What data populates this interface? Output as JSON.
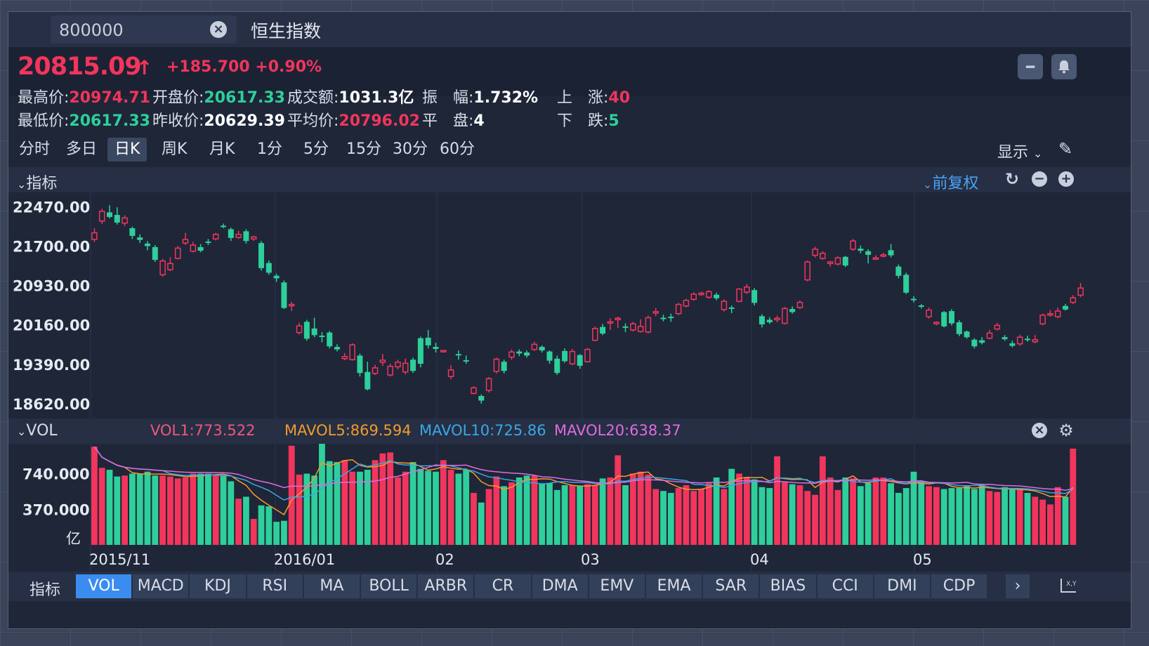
{
  "header": {
    "search_value": "800000",
    "index_name": "恒生指数"
  },
  "quote": {
    "price": "20815.09",
    "change": "+185.700",
    "change_pct": "+0.90%",
    "stats": {
      "high_label": "最高价:",
      "high": "20974.71",
      "open_label": "开盘价:",
      "open": "20617.33",
      "turnover_label": "成交额:",
      "turnover": "1031.3亿",
      "amp_label": "振　幅:",
      "amp": "1.732%",
      "up_label": "上　涨:",
      "up": "40",
      "low_label": "最低价:",
      "low": "20617.33",
      "prev_label": "昨收价:",
      "prev": "20629.39",
      "avg_label": "平均价:",
      "avg": "20796.02",
      "flat_label": "平　盘:",
      "flat": "4",
      "down_label": "下　跌:",
      "down": "5"
    }
  },
  "periods": [
    "分时",
    "多日",
    "日K",
    "周K",
    "月K",
    "1分",
    "5分",
    "15分",
    "30分",
    "60分"
  ],
  "active_period": "日K",
  "display_label": "显示",
  "indicator_section": {
    "label": "指标",
    "adjust": "前复权"
  },
  "vol_section": {
    "label": "VOL",
    "vol1": "VOL1:773.522",
    "mavol5": "MAVOL5:869.594",
    "mavol10": "MAVOL10:725.86",
    "mavol20": "MAVOL20:638.37"
  },
  "colors": {
    "up": "#f2355c",
    "down": "#2ecf9a",
    "ma5": "#f39a2c",
    "ma10": "#3aa8e6",
    "ma20": "#e06be0"
  },
  "chart_data": {
    "type": "candlestick",
    "y_ticks": [
      "22470.00",
      "21700.00",
      "20930.00",
      "20160.00",
      "19390.00",
      "18620.00"
    ],
    "ylim": [
      18330,
      22750
    ],
    "x_labels": [
      "2015/11",
      "2016/01",
      "02",
      "03",
      "04",
      "05"
    ],
    "candles": [
      [
        21830,
        21960,
        21780,
        22050
      ],
      [
        22190,
        22380,
        22130,
        22430
      ],
      [
        22360,
        22270,
        22240,
        22500
      ],
      [
        22310,
        22160,
        22120,
        22460
      ],
      [
        22150,
        22250,
        22090,
        22300
      ],
      [
        22050,
        21900,
        21840,
        22080
      ],
      [
        21870,
        21820,
        21760,
        21930
      ],
      [
        21750,
        21700,
        21620,
        21800
      ],
      [
        21680,
        21430,
        21390,
        21720
      ],
      [
        21140,
        21410,
        21100,
        21450
      ],
      [
        21240,
        21360,
        21210,
        21480
      ],
      [
        21460,
        21660,
        21440,
        21700
      ],
      [
        21760,
        21830,
        21720,
        21960
      ],
      [
        21600,
        21720,
        21580,
        21780
      ],
      [
        21680,
        21610,
        21580,
        21740
      ],
      [
        21790,
        21780,
        21720,
        21840
      ],
      [
        21840,
        21930,
        21810,
        21960
      ],
      [
        22100,
        22080,
        22050,
        22140
      ],
      [
        22030,
        21860,
        21800,
        22060
      ],
      [
        21870,
        21930,
        21840,
        22000
      ],
      [
        21990,
        21800,
        21750,
        22030
      ],
      [
        21840,
        21880,
        21800,
        21900
      ],
      [
        21760,
        21270,
        21220,
        21800
      ],
      [
        21370,
        21180,
        21140,
        21420
      ],
      [
        21120,
        21070,
        21000,
        21160
      ],
      [
        20990,
        20490,
        20470,
        21030
      ],
      [
        20540,
        20560,
        20430,
        20610
      ],
      [
        20010,
        20140,
        19970,
        20200
      ],
      [
        20220,
        19890,
        19850,
        20260
      ],
      [
        20090,
        19960,
        19920,
        20300
      ],
      [
        19950,
        19930,
        19820,
        20020
      ],
      [
        20010,
        19740,
        19700,
        20040
      ],
      [
        19730,
        19680,
        19640,
        19780
      ],
      [
        19500,
        19540,
        19470,
        19610
      ],
      [
        19480,
        19770,
        19460,
        19800
      ],
      [
        19560,
        19220,
        19150,
        19600
      ],
      [
        19240,
        18900,
        18880,
        19440
      ],
      [
        19210,
        19320,
        19180,
        19380
      ],
      [
        19430,
        19470,
        19360,
        19590
      ],
      [
        19180,
        19350,
        19150,
        19400
      ],
      [
        19340,
        19430,
        19290,
        19480
      ],
      [
        19240,
        19410,
        19190,
        19500
      ],
      [
        19480,
        19260,
        19220,
        19520
      ],
      [
        19900,
        19400,
        19330,
        19930
      ],
      [
        19910,
        19760,
        19700,
        20060
      ],
      [
        19730,
        19690,
        19620,
        19810
      ],
      [
        19650,
        19660,
        19620,
        19670
      ],
      [
        19150,
        19280,
        19100,
        19370
      ],
      [
        19590,
        19570,
        19480,
        19660
      ],
      [
        19470,
        19450,
        19400,
        19560
      ],
      [
        18820,
        18930,
        18800,
        18960
      ],
      [
        18770,
        18680,
        18620,
        18800
      ],
      [
        18880,
        19110,
        18840,
        19140
      ],
      [
        19250,
        19490,
        19210,
        19520
      ],
      [
        19440,
        19260,
        19210,
        19480
      ],
      [
        19530,
        19630,
        19480,
        19680
      ],
      [
        19640,
        19600,
        19550,
        19680
      ],
      [
        19620,
        19560,
        19520,
        19660
      ],
      [
        19680,
        19780,
        19650,
        19830
      ],
      [
        19730,
        19660,
        19620,
        19760
      ],
      [
        19640,
        19460,
        19400,
        19660
      ],
      [
        19500,
        19220,
        19180,
        19560
      ],
      [
        19650,
        19450,
        19420,
        19700
      ],
      [
        19400,
        19640,
        19370,
        19690
      ],
      [
        19570,
        19360,
        19300,
        19590
      ],
      [
        19440,
        19680,
        19420,
        19710
      ],
      [
        19860,
        20090,
        19840,
        20130
      ],
      [
        20120,
        19990,
        19960,
        20180
      ],
      [
        20220,
        20220,
        20060,
        20290
      ],
      [
        20270,
        20290,
        20100,
        20320
      ],
      [
        20130,
        20120,
        20020,
        20190
      ],
      [
        20060,
        20180,
        20030,
        20220
      ],
      [
        20030,
        20130,
        20010,
        20270
      ],
      [
        20020,
        20300,
        19990,
        20340
      ],
      [
        20400,
        20420,
        20330,
        20490
      ],
      [
        20300,
        20290,
        20230,
        20360
      ],
      [
        20320,
        20310,
        20220,
        20380
      ],
      [
        20380,
        20560,
        20350,
        20590
      ],
      [
        20530,
        20640,
        20500,
        20670
      ],
      [
        20660,
        20760,
        20630,
        20800
      ],
      [
        20760,
        20780,
        20730,
        20810
      ],
      [
        20700,
        20810,
        20670,
        20840
      ],
      [
        20750,
        20680,
        20640,
        20790
      ],
      [
        20460,
        20620,
        20420,
        20660
      ],
      [
        20500,
        20480,
        20390,
        20540
      ],
      [
        20620,
        20860,
        20600,
        20880
      ],
      [
        20800,
        20900,
        20760,
        20960
      ],
      [
        20840,
        20590,
        20540,
        20880
      ],
      [
        20330,
        20170,
        20110,
        20370
      ],
      [
        20260,
        20210,
        20180,
        20310
      ],
      [
        20260,
        20290,
        20210,
        20340
      ],
      [
        20190,
        20480,
        20170,
        20510
      ],
      [
        20470,
        20410,
        20380,
        20520
      ],
      [
        20500,
        20600,
        20470,
        20640
      ],
      [
        21040,
        21390,
        21010,
        21420
      ],
      [
        21520,
        21640,
        21480,
        21690
      ],
      [
        21460,
        21560,
        21430,
        21600
      ],
      [
        21360,
        21390,
        21300,
        21410
      ],
      [
        21350,
        21470,
        21320,
        21500
      ],
      [
        21490,
        21320,
        21290,
        21510
      ],
      [
        21640,
        21800,
        21610,
        21840
      ],
      [
        21650,
        21610,
        21560,
        21710
      ],
      [
        21600,
        21530,
        21360,
        21640
      ],
      [
        21460,
        21470,
        21430,
        21520
      ],
      [
        21520,
        21530,
        21480,
        21570
      ],
      [
        21620,
        21520,
        21480,
        21740
      ],
      [
        21300,
        21120,
        21070,
        21340
      ],
      [
        21140,
        20790,
        20760,
        21180
      ],
      [
        20670,
        20650,
        20600,
        20720
      ],
      [
        20540,
        20530,
        20480,
        20570
      ],
      [
        20320,
        20450,
        20280,
        20500
      ],
      [
        20180,
        20210,
        20150,
        20230
      ],
      [
        20410,
        20130,
        20110,
        20430
      ],
      [
        20430,
        20190,
        20150,
        20470
      ],
      [
        20210,
        19980,
        19940,
        20250
      ],
      [
        20030,
        19920,
        19890,
        20050
      ],
      [
        19870,
        19740,
        19700,
        19900
      ],
      [
        19860,
        19810,
        19780,
        19920
      ],
      [
        19900,
        20000,
        19880,
        20060
      ],
      [
        20080,
        20150,
        20050,
        20200
      ],
      [
        19920,
        19880,
        19850,
        19960
      ],
      [
        19800,
        19750,
        19720,
        19850
      ],
      [
        19790,
        19920,
        19750,
        19970
      ],
      [
        19890,
        19880,
        19830,
        19950
      ],
      [
        19830,
        19870,
        19800,
        19960
      ],
      [
        20180,
        20350,
        20150,
        20380
      ],
      [
        20360,
        20380,
        20320,
        20450
      ],
      [
        20320,
        20430,
        20290,
        20500
      ],
      [
        20530,
        20460,
        20440,
        20570
      ],
      [
        20600,
        20690,
        20570,
        20740
      ],
      [
        20740,
        20880,
        20700,
        20980
      ]
    ],
    "volume": {
      "y_ticks": [
        "740.000",
        "370.000"
      ],
      "unit": "亿",
      "ylim": [
        0,
        1050
      ],
      "values": [
        1020,
        800,
        780,
        710,
        720,
        740,
        740,
        760,
        720,
        720,
        710,
        690,
        700,
        740,
        740,
        740,
        730,
        720,
        660,
        480,
        500,
        270,
        410,
        400,
        240,
        250,
        1030,
        730,
        740,
        720,
        1050,
        870,
        860,
        880,
        760,
        760,
        780,
        880,
        950,
        960,
        700,
        760,
        860,
        790,
        770,
        760,
        880,
        780,
        740,
        780,
        540,
        440,
        580,
        710,
        610,
        650,
        700,
        720,
        720,
        640,
        640,
        570,
        620,
        620,
        610,
        630,
        620,
        690,
        700,
        930,
        620,
        740,
        760,
        730,
        580,
        560,
        540,
        590,
        620,
        560,
        580,
        640,
        700,
        580,
        790,
        740,
        700,
        680,
        600,
        590,
        920,
        650,
        630,
        620,
        560,
        520,
        920,
        700,
        570,
        700,
        690,
        610,
        640,
        700,
        700,
        640,
        540,
        590,
        760,
        660,
        610,
        600,
        580,
        590,
        590,
        610,
        580,
        620,
        560,
        550,
        600,
        580,
        580,
        540,
        500,
        470,
        420,
        600,
        500,
        1000
      ]
    }
  },
  "bottom_tabs": {
    "label": "指标",
    "tabs": [
      "VOL",
      "MACD",
      "KDJ",
      "RSI",
      "MA",
      "BOLL",
      "ARBR",
      "CR",
      "DMA",
      "EMV",
      "EMA",
      "SAR",
      "BIAS",
      "CCI",
      "DMI",
      "CDP"
    ],
    "active": "VOL",
    "more": "›"
  }
}
